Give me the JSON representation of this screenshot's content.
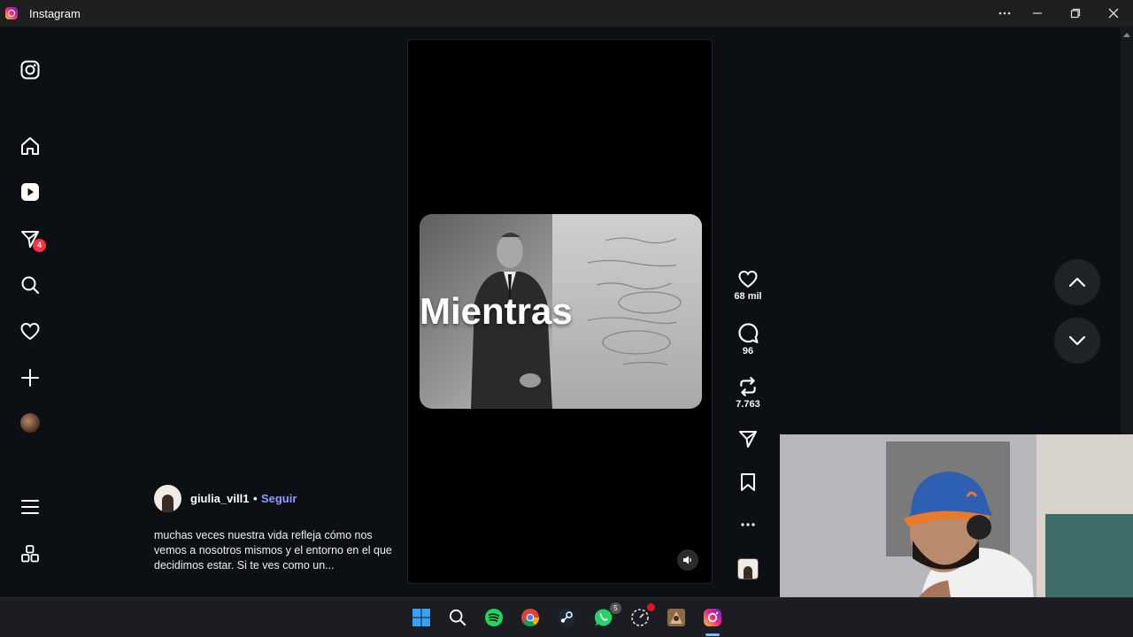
{
  "window": {
    "title": "Instagram"
  },
  "sidebar": {
    "message_badge": "4"
  },
  "reel": {
    "overlay_text": "Mientras"
  },
  "actions": {
    "likes": "68 mil",
    "comments": "96",
    "reposts": "7.763"
  },
  "caption": {
    "username": "giulia_vill1",
    "separator": "•",
    "follow_label": "Seguir",
    "text": "muchas veces nuestra vida refleja cómo nos vemos a nosotros mismos y el entorno en el que decidimos estar. Si te ves como un..."
  },
  "taskbar": {
    "whatsapp_badge": "5"
  },
  "colors": {
    "accent_follow": "#8e9bff",
    "badge": "#ff3040",
    "background": "#0c0f13"
  }
}
